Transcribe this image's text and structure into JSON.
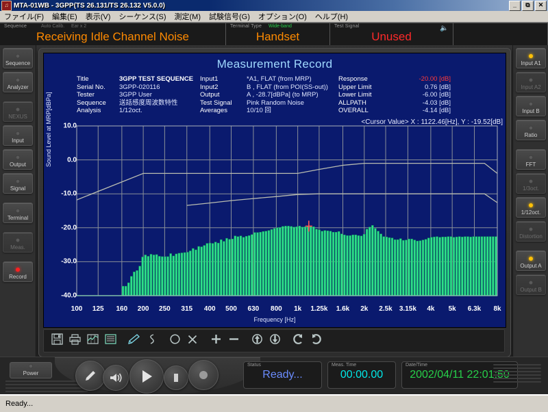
{
  "window": {
    "title": "MTA-01WB - 3GPP(TS 26.131/TS 26.132 V5.0.0)",
    "icon": "app-icon",
    "minimize": "_",
    "maximize": "⧉",
    "close": "✕"
  },
  "menu": [
    "ファイル(F)",
    "編集(E)",
    "表示(V)",
    "シーケンス(S)",
    "測定(M)",
    "試験信号(G)",
    "オプション(O)",
    "ヘルプ(H)"
  ],
  "banner": {
    "sequence_label": "Sequence",
    "sequence_sub1": "Auto Calib.",
    "sequence_sub2": "Ear x 2",
    "sequence_value": "Receiving Idle Channel Noise",
    "terminal_label": "Terminal Type",
    "terminal_mode": "Wide-band",
    "terminal_value": "Handset",
    "signal_label": "Test Signal",
    "signal_value": "Unused",
    "speaker_icon": "speaker-mute-icon"
  },
  "left_rail": [
    {
      "label": "Sequence",
      "led": "off",
      "dim": false
    },
    {
      "label": "Analyzer",
      "led": "off",
      "dim": false
    },
    {
      "label": "NEXUS",
      "led": "off",
      "dim": true
    },
    {
      "label": "Input",
      "led": "off",
      "dim": false
    },
    {
      "label": "Output",
      "led": "off",
      "dim": false
    },
    {
      "label": "Signal",
      "led": "off",
      "dim": false
    },
    {
      "label": "Terminal",
      "led": "off",
      "dim": false
    },
    {
      "label": "Meas.",
      "led": "off",
      "dim": true
    },
    {
      "label": "Record",
      "led": "on-r",
      "dim": false
    }
  ],
  "right_rail": [
    {
      "label": "Input A1",
      "led": "on-y",
      "dim": false
    },
    {
      "label": "Input A2",
      "led": "off",
      "dim": true
    },
    {
      "label": "Input B",
      "led": "off",
      "dim": false
    },
    {
      "label": "Ratio",
      "led": "off",
      "dim": false
    },
    {
      "label": "FFT",
      "led": "off",
      "dim": false
    },
    {
      "label": "1/3oct.",
      "led": "off",
      "dim": true
    },
    {
      "label": "1/12oct.",
      "led": "on-y",
      "dim": false
    },
    {
      "label": "Distortion",
      "led": "off",
      "dim": true
    },
    {
      "label": "Output A",
      "led": "on-y",
      "dim": false
    },
    {
      "label": "Output B",
      "led": "off",
      "dim": true
    }
  ],
  "record": {
    "heading": "Measurement Record",
    "col1": [
      {
        "key": "Title",
        "value": "3GPP TEST SEQUENCE",
        "style": "bold"
      },
      {
        "key": "Serial No.",
        "value": "3GPP-020116",
        "style": ""
      },
      {
        "key": "Tester",
        "value": "3GPP User",
        "style": ""
      },
      {
        "key": "Sequence",
        "value": "送話感度周波数特性",
        "style": ""
      },
      {
        "key": "Analysis",
        "value": "1/12oct.",
        "style": ""
      }
    ],
    "col2": [
      {
        "key": "Input1",
        "value": "*A1, FLAT (from MRP)",
        "style": ""
      },
      {
        "key": "Input2",
        "value": "B , FLAT (from POI(SS-out))",
        "style": ""
      },
      {
        "key": "Output",
        "value": "A , -28.7[dBPa] (to MRP)",
        "style": ""
      },
      {
        "key": "Test Signal",
        "value": "Pink Random Noise",
        "style": ""
      },
      {
        "key": "Averages",
        "value": "10/10 回",
        "style": ""
      }
    ],
    "col3": [
      {
        "key": "Response",
        "value": "-20.00 [dB]",
        "style": "redv"
      },
      {
        "key": "Upper Limit",
        "value": "0.76 [dB]",
        "style": ""
      },
      {
        "key": "Lower Limit",
        "value": "-6.00 [dB]",
        "style": ""
      },
      {
        "key": "ALLPATH",
        "value": "-4.03 [dB]",
        "style": ""
      },
      {
        "key": "OVERALL",
        "value": "-4.14 [dB]",
        "style": ""
      }
    ]
  },
  "chart_data": {
    "type": "bar",
    "title": "Measurement Record",
    "xlabel": "Frequency [Hz]",
    "ylabel": "Sound Level at MRP[dBPa]",
    "ylim": [
      -40.0,
      10.0
    ],
    "yticks": [
      "10.0",
      "0.0",
      "-10.0",
      "-20.0",
      "-30.0",
      "-40.0"
    ],
    "ytick_values": [
      10.0,
      0.0,
      -10.0,
      -20.0,
      -30.0,
      -40.0
    ],
    "xticks": [
      "100",
      "125",
      "160",
      "200",
      "250",
      "315",
      "400",
      "500",
      "630",
      "800",
      "1k",
      "1.25k",
      "1.6k",
      "2k",
      "2.5k",
      "3.15k",
      "4k",
      "5k",
      "6.3k",
      "8k"
    ],
    "xtick_values": [
      100,
      125,
      160,
      200,
      250,
      315,
      400,
      500,
      630,
      800,
      1000,
      1250,
      1600,
      2000,
      2500,
      3150,
      4000,
      5000,
      6300,
      8000
    ],
    "grid": true,
    "legend": "none",
    "bar_color": "#2ee08a",
    "plot_bg": "#0a1a6e",
    "grid_color": "#8a9098",
    "cursor": {
      "label": "<Cursor Value>",
      "x_text": "X : 1122.46[Hz]",
      "y_text": "Y : -19.52[dB]",
      "full_text": "<Cursor Value> X : 1122.46[Hz], Y : -19.52[dB]",
      "x": 1122.46,
      "y": -19.52,
      "color": "#ff5555"
    },
    "series": [
      {
        "name": "Sound Level",
        "type": "bar",
        "x": [
          100,
          103,
          106,
          109,
          112,
          116,
          119,
          123,
          126,
          130,
          134,
          138,
          142,
          146,
          150,
          155,
          159,
          164,
          169,
          174,
          179,
          184,
          190,
          195,
          201,
          207,
          213,
          219,
          226,
          232,
          239,
          246,
          253,
          261,
          268,
          276,
          284,
          293,
          301,
          310,
          319,
          329,
          338,
          348,
          358,
          369,
          380,
          391,
          403,
          415,
          427,
          439,
          452,
          466,
          479,
          493,
          508,
          523,
          538,
          554,
          570,
          587,
          604,
          622,
          640,
          659,
          678,
          698,
          719,
          740,
          762,
          784,
          807,
          831,
          856,
          881,
          907,
          933,
          961,
          989,
          1018,
          1048,
          1079,
          1111,
          1143,
          1177,
          1212,
          1247,
          1284,
          1321,
          1360,
          1400,
          1441,
          1484,
          1527,
          1572,
          1618,
          1666,
          1715,
          1765,
          1817,
          1871,
          1926,
          1983,
          2041,
          2101,
          2163,
          2226,
          2292,
          2359,
          2428,
          2500,
          2573,
          2649,
          2727,
          2807,
          2889,
          2974,
          3062,
          3152,
          3244,
          3339,
          3438,
          3539,
          3643,
          3750,
          3861,
          3974,
          4091,
          4211,
          4335,
          4463,
          4594,
          4729,
          4868,
          5012,
          5159,
          5311,
          5467,
          5629,
          5794,
          5965,
          6141,
          6322,
          6509,
          6701,
          6899,
          7102,
          7312,
          7528,
          7750,
          7979,
          8000
        ],
        "values": [
          -40,
          -40,
          -40,
          -40,
          -40,
          -40,
          -40,
          -40,
          -40,
          -40,
          -40,
          -40,
          -40,
          -40,
          -40,
          -40,
          -37.2,
          -37.2,
          -36.2,
          -34.3,
          -33.0,
          -32.6,
          -31.3,
          -28.6,
          -28.0,
          -28.4,
          -27.8,
          -28.0,
          -27.9,
          -28.4,
          -28.5,
          -28.5,
          -28.5,
          -27.6,
          -28.3,
          -27.7,
          -27.5,
          -27.4,
          -27.3,
          -27.2,
          -26.8,
          -26.1,
          -26.5,
          -25.5,
          -25.6,
          -25.2,
          -24.6,
          -24.5,
          -24.6,
          -24.2,
          -24.5,
          -23.5,
          -24.0,
          -23.1,
          -23.4,
          -23.3,
          -22.4,
          -22.6,
          -22.4,
          -22.8,
          -22.5,
          -22.3,
          -22.0,
          -21.4,
          -21.4,
          -21.3,
          -21.1,
          -21.0,
          -20.8,
          -20.5,
          -20.2,
          -20.0,
          -19.9,
          -19.6,
          -19.5,
          -19.5,
          -19.6,
          -19.8,
          -19.7,
          -19.5,
          -19.8,
          -19.7,
          -19.5,
          -19.5,
          -19.7,
          -20.4,
          -20.6,
          -21.0,
          -20.8,
          -20.9,
          -21.0,
          -21.3,
          -21.3,
          -21.1,
          -21.8,
          -22.1,
          -22.3,
          -22.3,
          -22.1,
          -22.1,
          -22.3,
          -22.4,
          -21.9,
          -20.4,
          -19.8,
          -19.3,
          -20.2,
          -21.0,
          -21.8,
          -22.6,
          -22.7,
          -22.9,
          -23.0,
          -23.5,
          -23.5,
          -23.2,
          -23.7,
          -23.6,
          -23.3,
          -23.3,
          -23.6,
          -23.9,
          -23.8,
          -23.6,
          -23.4,
          -23.0,
          -22.8,
          -22.7,
          -22.6,
          -22.8,
          -22.7,
          -22.7,
          -22.6,
          -22.6,
          -22.8,
          -22.7,
          -22.6,
          -22.7,
          -22.6,
          -22.6,
          -22.7,
          -22.6,
          -22.6,
          -22.6,
          -22.6,
          -22.6,
          -22.6,
          -22.6,
          -22.6,
          -22.6
        ]
      },
      {
        "name": "Upper Limit Mask",
        "type": "line",
        "color": "#b9bcb0",
        "points": [
          [
            100,
            -11.8
          ],
          [
            200,
            -4.0
          ],
          [
            315,
            -4.0
          ],
          [
            400,
            -4.0
          ],
          [
            500,
            -4.0
          ],
          [
            630,
            -4.0
          ],
          [
            800,
            -4.0
          ],
          [
            1000,
            -4.0
          ],
          [
            1250,
            -2.8
          ],
          [
            1600,
            -1.6
          ],
          [
            2000,
            -1.0
          ],
          [
            2500,
            -1.0
          ],
          [
            3150,
            -1.0
          ],
          [
            4000,
            -1.0
          ],
          [
            5000,
            -1.0
          ],
          [
            6300,
            -1.0
          ],
          [
            7000,
            -1.0
          ],
          [
            8000,
            -4.0
          ]
        ]
      },
      {
        "name": "Lower Limit Mask",
        "type": "line",
        "color": "#b9bcb0",
        "points": [
          [
            315,
            -13.4
          ],
          [
            400,
            -12.7
          ],
          [
            500,
            -12.0
          ],
          [
            630,
            -11.4
          ],
          [
            800,
            -10.8
          ],
          [
            1000,
            -10.2
          ],
          [
            1250,
            -10.0
          ],
          [
            1600,
            -10.0
          ],
          [
            2000,
            -10.0
          ],
          [
            2500,
            -10.0
          ],
          [
            3150,
            -10.0
          ],
          [
            4000,
            -10.0
          ],
          [
            5000,
            -10.0
          ],
          [
            6300,
            -10.0
          ],
          [
            7000,
            -10.0
          ],
          [
            8000,
            -12.6
          ]
        ]
      }
    ]
  },
  "toolbar": [
    {
      "icon": "save-icon",
      "name": "save-button"
    },
    {
      "icon": "print-icon",
      "name": "print-button"
    },
    {
      "icon": "graph-icon",
      "name": "graph-view-button"
    },
    {
      "icon": "list-icon",
      "name": "list-view-button"
    },
    {
      "icon": "pen-icon",
      "name": "pen-tool-button"
    },
    {
      "icon": "curve-icon",
      "name": "curve-tool-button"
    },
    {
      "icon": "circle-icon",
      "name": "circle-marker-button"
    },
    {
      "icon": "cross-icon",
      "name": "delete-marker-button"
    },
    {
      "icon": "plus-icon",
      "name": "zoom-in-button"
    },
    {
      "icon": "minus-icon",
      "name": "zoom-out-button"
    },
    {
      "icon": "arrow-up-icon",
      "name": "scroll-up-button"
    },
    {
      "icon": "arrow-down-icon",
      "name": "scroll-down-button"
    },
    {
      "icon": "undo-icon",
      "name": "undo-button"
    },
    {
      "icon": "redo-icon",
      "name": "redo-button"
    }
  ],
  "transport": {
    "power_label": "Power",
    "buttons": [
      {
        "icon": "mic-icon",
        "name": "mic-button"
      },
      {
        "icon": "speaker-icon",
        "name": "monitor-button"
      },
      {
        "icon": "play-icon",
        "name": "play-button"
      },
      {
        "icon": "stop-icon",
        "name": "stop-button"
      },
      {
        "icon": "record-icon",
        "name": "record-button"
      }
    ]
  },
  "status_panels": {
    "status_label": "Status",
    "status_value": "Ready...",
    "meas_time_label": "Meas. Time",
    "meas_time_value": "00:00.00",
    "datetime_label": "Date/Time",
    "datetime_value": "2002/04/11 22:01:50"
  },
  "taskbar": {
    "status": "Ready..."
  }
}
